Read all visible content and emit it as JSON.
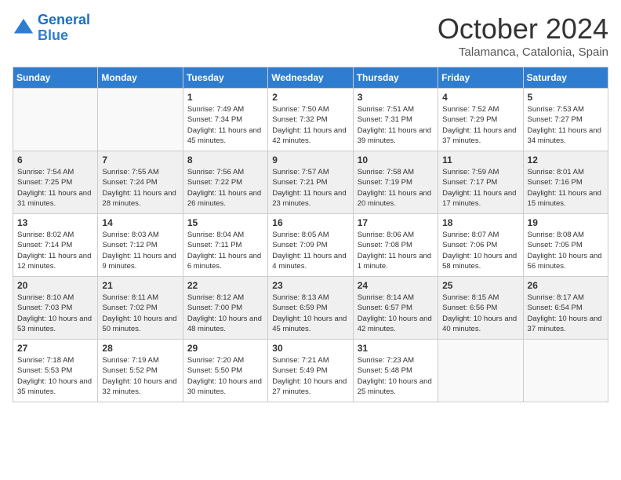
{
  "header": {
    "logo_line1": "General",
    "logo_line2": "Blue",
    "month": "October 2024",
    "location": "Talamanca, Catalonia, Spain"
  },
  "days_of_week": [
    "Sunday",
    "Monday",
    "Tuesday",
    "Wednesday",
    "Thursday",
    "Friday",
    "Saturday"
  ],
  "weeks": [
    [
      {
        "num": "",
        "info": ""
      },
      {
        "num": "",
        "info": ""
      },
      {
        "num": "1",
        "info": "Sunrise: 7:49 AM\nSunset: 7:34 PM\nDaylight: 11 hours and 45 minutes."
      },
      {
        "num": "2",
        "info": "Sunrise: 7:50 AM\nSunset: 7:32 PM\nDaylight: 11 hours and 42 minutes."
      },
      {
        "num": "3",
        "info": "Sunrise: 7:51 AM\nSunset: 7:31 PM\nDaylight: 11 hours and 39 minutes."
      },
      {
        "num": "4",
        "info": "Sunrise: 7:52 AM\nSunset: 7:29 PM\nDaylight: 11 hours and 37 minutes."
      },
      {
        "num": "5",
        "info": "Sunrise: 7:53 AM\nSunset: 7:27 PM\nDaylight: 11 hours and 34 minutes."
      }
    ],
    [
      {
        "num": "6",
        "info": "Sunrise: 7:54 AM\nSunset: 7:25 PM\nDaylight: 11 hours and 31 minutes."
      },
      {
        "num": "7",
        "info": "Sunrise: 7:55 AM\nSunset: 7:24 PM\nDaylight: 11 hours and 28 minutes."
      },
      {
        "num": "8",
        "info": "Sunrise: 7:56 AM\nSunset: 7:22 PM\nDaylight: 11 hours and 26 minutes."
      },
      {
        "num": "9",
        "info": "Sunrise: 7:57 AM\nSunset: 7:21 PM\nDaylight: 11 hours and 23 minutes."
      },
      {
        "num": "10",
        "info": "Sunrise: 7:58 AM\nSunset: 7:19 PM\nDaylight: 11 hours and 20 minutes."
      },
      {
        "num": "11",
        "info": "Sunrise: 7:59 AM\nSunset: 7:17 PM\nDaylight: 11 hours and 17 minutes."
      },
      {
        "num": "12",
        "info": "Sunrise: 8:01 AM\nSunset: 7:16 PM\nDaylight: 11 hours and 15 minutes."
      }
    ],
    [
      {
        "num": "13",
        "info": "Sunrise: 8:02 AM\nSunset: 7:14 PM\nDaylight: 11 hours and 12 minutes."
      },
      {
        "num": "14",
        "info": "Sunrise: 8:03 AM\nSunset: 7:12 PM\nDaylight: 11 hours and 9 minutes."
      },
      {
        "num": "15",
        "info": "Sunrise: 8:04 AM\nSunset: 7:11 PM\nDaylight: 11 hours and 6 minutes."
      },
      {
        "num": "16",
        "info": "Sunrise: 8:05 AM\nSunset: 7:09 PM\nDaylight: 11 hours and 4 minutes."
      },
      {
        "num": "17",
        "info": "Sunrise: 8:06 AM\nSunset: 7:08 PM\nDaylight: 11 hours and 1 minute."
      },
      {
        "num": "18",
        "info": "Sunrise: 8:07 AM\nSunset: 7:06 PM\nDaylight: 10 hours and 58 minutes."
      },
      {
        "num": "19",
        "info": "Sunrise: 8:08 AM\nSunset: 7:05 PM\nDaylight: 10 hours and 56 minutes."
      }
    ],
    [
      {
        "num": "20",
        "info": "Sunrise: 8:10 AM\nSunset: 7:03 PM\nDaylight: 10 hours and 53 minutes."
      },
      {
        "num": "21",
        "info": "Sunrise: 8:11 AM\nSunset: 7:02 PM\nDaylight: 10 hours and 50 minutes."
      },
      {
        "num": "22",
        "info": "Sunrise: 8:12 AM\nSunset: 7:00 PM\nDaylight: 10 hours and 48 minutes."
      },
      {
        "num": "23",
        "info": "Sunrise: 8:13 AM\nSunset: 6:59 PM\nDaylight: 10 hours and 45 minutes."
      },
      {
        "num": "24",
        "info": "Sunrise: 8:14 AM\nSunset: 6:57 PM\nDaylight: 10 hours and 42 minutes."
      },
      {
        "num": "25",
        "info": "Sunrise: 8:15 AM\nSunset: 6:56 PM\nDaylight: 10 hours and 40 minutes."
      },
      {
        "num": "26",
        "info": "Sunrise: 8:17 AM\nSunset: 6:54 PM\nDaylight: 10 hours and 37 minutes."
      }
    ],
    [
      {
        "num": "27",
        "info": "Sunrise: 7:18 AM\nSunset: 5:53 PM\nDaylight: 10 hours and 35 minutes."
      },
      {
        "num": "28",
        "info": "Sunrise: 7:19 AM\nSunset: 5:52 PM\nDaylight: 10 hours and 32 minutes."
      },
      {
        "num": "29",
        "info": "Sunrise: 7:20 AM\nSunset: 5:50 PM\nDaylight: 10 hours and 30 minutes."
      },
      {
        "num": "30",
        "info": "Sunrise: 7:21 AM\nSunset: 5:49 PM\nDaylight: 10 hours and 27 minutes."
      },
      {
        "num": "31",
        "info": "Sunrise: 7:23 AM\nSunset: 5:48 PM\nDaylight: 10 hours and 25 minutes."
      },
      {
        "num": "",
        "info": ""
      },
      {
        "num": "",
        "info": ""
      }
    ]
  ]
}
